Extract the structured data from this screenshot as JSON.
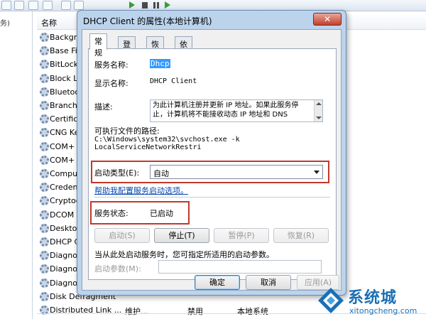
{
  "left_pane": {
    "label": "务)"
  },
  "list": {
    "header_name": "名称",
    "rows": [
      {
        "name": "Backgr",
        "desc": "",
        "status": "",
        "logon": ""
      },
      {
        "name": "Base Fil",
        "desc": "",
        "status": "",
        "logon": ""
      },
      {
        "name": "BitLock",
        "desc": "",
        "status": "",
        "logon": ""
      },
      {
        "name": "Block Le",
        "desc": "",
        "status": "",
        "logon": ""
      },
      {
        "name": "Bluetoo",
        "desc": "",
        "status": "",
        "logon": ""
      },
      {
        "name": "BranchC",
        "desc": "",
        "status": "",
        "logon": ""
      },
      {
        "name": "Certifica",
        "desc": "",
        "status": "",
        "logon": ""
      },
      {
        "name": "CNG Ke",
        "desc": "",
        "status": "",
        "logon": ""
      },
      {
        "name": "COM+ ",
        "desc": "",
        "status": "",
        "logon": ""
      },
      {
        "name": "COM+ ",
        "desc": "",
        "status": "",
        "logon": ""
      },
      {
        "name": "Compu",
        "desc": "",
        "status": "",
        "logon": ""
      },
      {
        "name": "Creden",
        "desc": "",
        "status": "",
        "logon": ""
      },
      {
        "name": "Cryptog",
        "desc": "",
        "status": "",
        "logon": ""
      },
      {
        "name": "DCOM",
        "desc": "",
        "status": "",
        "logon": ""
      },
      {
        "name": "Desktop",
        "desc": "",
        "status": "",
        "logon": ""
      },
      {
        "name": "DHCP C",
        "desc": "",
        "status": "",
        "logon": ""
      },
      {
        "name": "Diagno",
        "desc": "",
        "status": "",
        "logon": ""
      },
      {
        "name": "Diagno",
        "desc": "",
        "status": "",
        "logon": ""
      },
      {
        "name": "Diagno",
        "desc": "",
        "status": "",
        "logon": ""
      },
      {
        "name": "Disk Defragment",
        "desc": "",
        "status": "",
        "logon": ""
      },
      {
        "name": "Distributed Link ...",
        "desc": "维护...",
        "status": "禁用",
        "logon": "本地系统"
      }
    ]
  },
  "dialog": {
    "title": "DHCP Client 的属性(本地计算机)",
    "close_label": "✕",
    "tabs": [
      "常规",
      "登录",
      "恢复",
      "依存关系"
    ],
    "service_name_label": "服务名称:",
    "service_name_value": "Dhcp",
    "display_name_label": "显示名称:",
    "display_name_value": "DHCP Client",
    "description_label": "描述:",
    "description_value": "为此计算机注册并更新 IP 地址。如果此服务停止，计算机将不能接收动态 IP 地址和 DNS",
    "path_label": "可执行文件的路径:",
    "path_value": "C:\\Windows\\system32\\svchost.exe -k LocalServiceNetworkRestri",
    "startup_type_label": "启动类型(E):",
    "startup_type_value": "自动",
    "help_link": "帮助我配置服务启动选项。",
    "status_label": "服务状态:",
    "status_value": "已启动",
    "buttons": {
      "start": "启动(S)",
      "stop": "停止(T)",
      "pause": "暂停(P)",
      "resume": "恢复(R)"
    },
    "hint_text": "当从此处启动服务时，您可指定所适用的启动参数。",
    "start_params_label": "启动参数(M):",
    "start_params_value": "",
    "footer": {
      "ok": "确定",
      "cancel": "取消",
      "apply": "应用(A)"
    }
  },
  "watermark": {
    "text_cn": "系统城",
    "text_url": "xitongcheng.com"
  }
}
